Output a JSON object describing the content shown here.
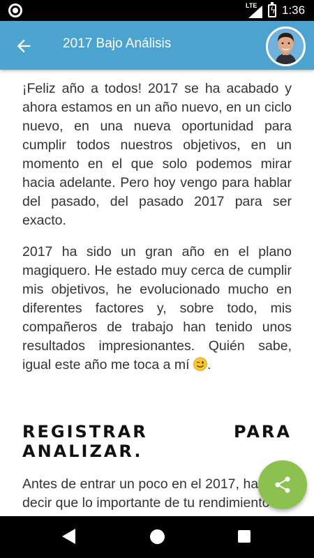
{
  "status_bar": {
    "network": "LTE",
    "time": "1:36",
    "icons": [
      "camera-indicator-icon",
      "signal-icon",
      "battery-charging-icon"
    ]
  },
  "app_bar": {
    "title": "2017 Bajo Análisis",
    "back_icon": "arrow-left-icon",
    "avatar": "profile-avatar"
  },
  "article": {
    "paragraphs": [
      "¡Feliz año a todos! 2017 se ha acabado y ahora estamos en un año nuevo, en un ciclo nuevo, en una nueva oportunidad para cumplir todos nuestros objetivos, en un momento en el que solo podemos mirar hacia adelante. Pero hoy vengo para hablar del pasado, del pasado 2017 para ser exacto.",
      "2017 ha sido un gran año en el plano magiquero. He estado muy cerca de cumplir mis objetivos, he evolucionado mucho en diferentes factores y, sobre todo, mis compañeros de trabajo han tenido unos resultados impresionantes. Quién sabe, igual este año me toca a mí",
      "Antes de entrar un poco en el 2017, hay que decir que lo importante de tu rendimiento"
    ],
    "heading": "REGISTRAR PARA ANALIZAR.",
    "emoji_after_p2": "winking-face-emoji",
    "p2_end": "."
  },
  "fab": {
    "icon": "share-icon"
  },
  "nav_bar": {
    "icons": [
      "nav-back-icon",
      "nav-home-icon",
      "nav-recents-icon"
    ]
  },
  "colors": {
    "app_bar": "#4da3cf",
    "fab": "#8cc04f",
    "text": "#333333",
    "heading": "#111111"
  }
}
